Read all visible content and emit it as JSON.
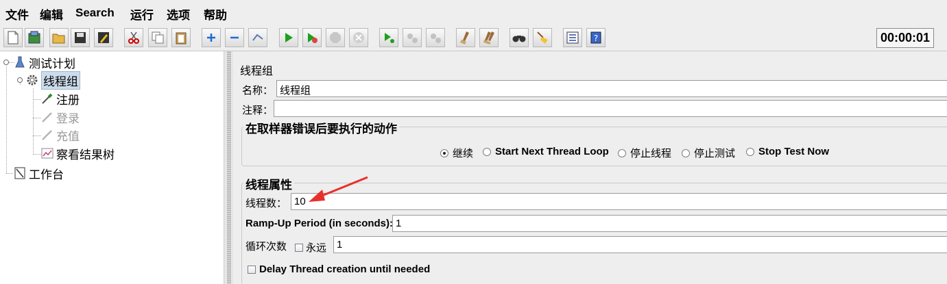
{
  "menu": [
    "文件",
    "编辑",
    "Search",
    "运行",
    "选项",
    "帮助"
  ],
  "toolbar_icons": [
    "new-icon",
    "templates-icon",
    "open-icon",
    "save-icon",
    "save-as-icon",
    "cut-icon",
    "copy-icon",
    "paste-icon",
    "expand-icon",
    "collapse-icon",
    "toggle-icon",
    "start-icon",
    "start-no-pause-icon",
    "stop-icon",
    "shutdown-icon",
    "remote-start-icon",
    "remote-stop-icon",
    "remote-shutdown-icon",
    "clear-icon",
    "clear-all-icon",
    "search-binoculars-icon",
    "reset-search-broom-icon",
    "function-helper-icon",
    "help-icon"
  ],
  "timer": "00:00:01",
  "tree": {
    "test_plan": "测试计划",
    "thread_group": "线程组",
    "register": "注册",
    "login": "登录",
    "recharge": "充值",
    "view_results_tree": "察看结果树",
    "workbench": "工作台"
  },
  "panel": {
    "title": "线程组",
    "name_label": "名称：",
    "name_value": "线程组",
    "comment_label": "注释：",
    "comment_value": "",
    "error_group_title": "在取样器错误后要执行的动作",
    "error_actions": [
      {
        "label": "继续",
        "selected": true
      },
      {
        "label": "Start Next Thread Loop",
        "selected": false
      },
      {
        "label": "停止线程",
        "selected": false
      },
      {
        "label": "停止测试",
        "selected": false
      },
      {
        "label": "Stop Test Now",
        "selected": false
      }
    ],
    "props_title": "线程属性",
    "threads_label": "线程数：",
    "threads_value": "10",
    "rampup_label": "Ramp-Up Period (in seconds):",
    "rampup_value": "1",
    "loop_label": "循环次数",
    "forever_label": "永远",
    "loop_value": "1",
    "delay_label": "Delay Thread creation until needed"
  },
  "colors": {
    "selection": "#cddcec",
    "annotation_arrow": "#e8302a"
  }
}
